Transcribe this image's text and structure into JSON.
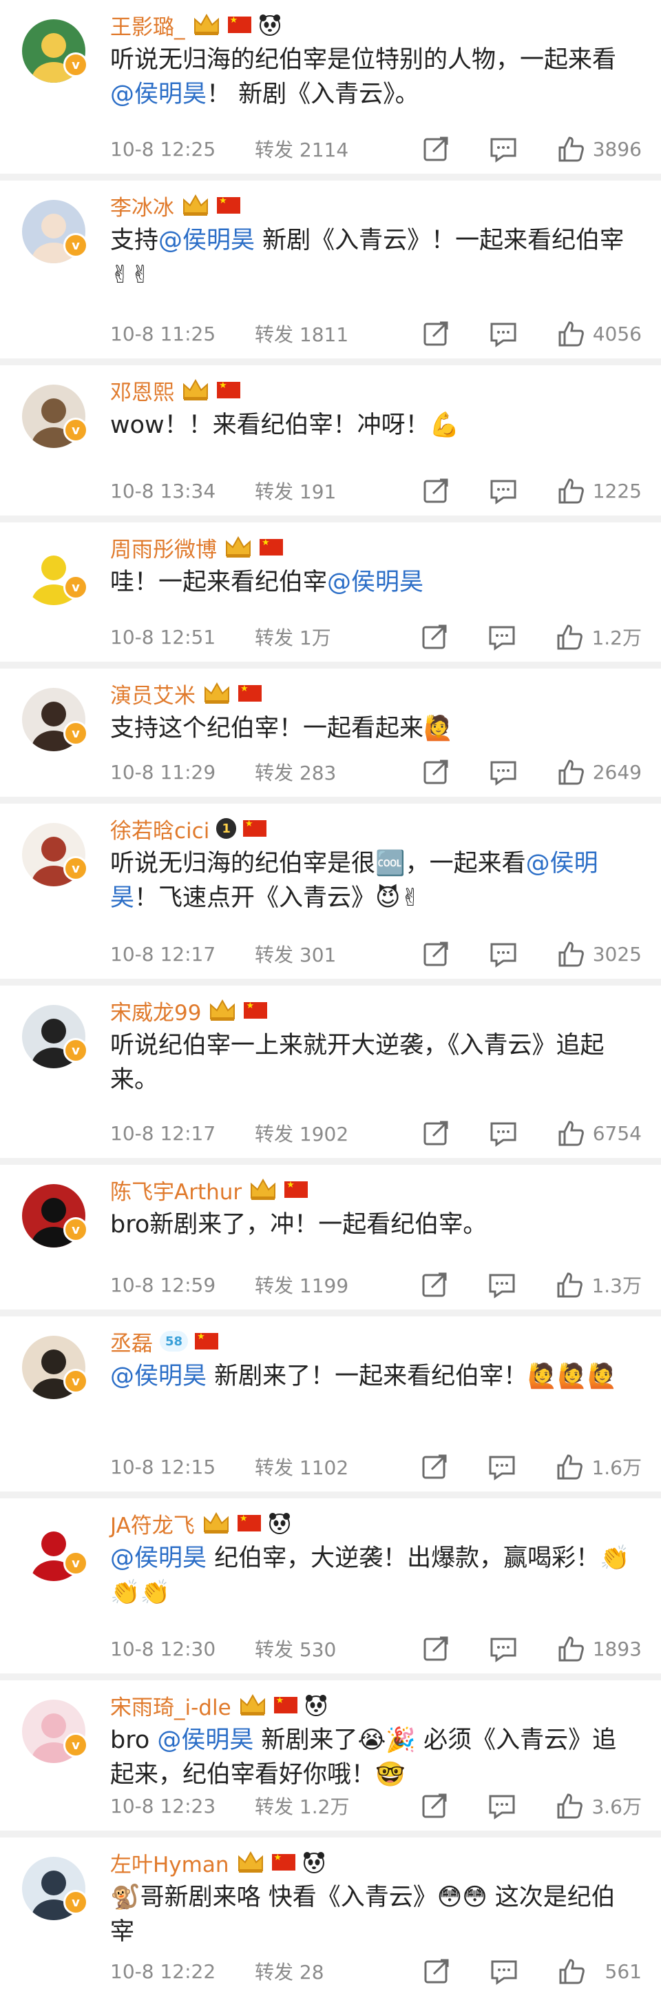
{
  "labels": {
    "share_prefix": "转发"
  },
  "colors": {
    "username": "#e07a2c",
    "mention": "#2b6ec7",
    "meta": "#8a8a8a",
    "verified": "#f5a623"
  },
  "comments": [
    {
      "name": "王影璐_",
      "text": "听说无归海的纪伯宰是位特别的人物，一起来看@侯明昊！ 新剧《入青云》。",
      "date": "10-8 12:25",
      "shares": "2114",
      "likes": "3896",
      "badges": [
        "crown",
        "flag",
        "panda"
      ]
    },
    {
      "name": "李冰冰",
      "text": "支持@侯明昊 新剧《入青云》！一起来看纪伯宰✌✌",
      "date": "10-8 11:25",
      "shares": "1811",
      "likes": "4056",
      "badges": [
        "crown",
        "flag"
      ]
    },
    {
      "name": "邓恩熙",
      "text": "wow！！来看纪伯宰！冲呀！💪",
      "date": "10-8 13:34",
      "shares": "191",
      "likes": "1225",
      "badges": [
        "crown",
        "flag"
      ]
    },
    {
      "name": "周雨彤微博",
      "text": "哇！一起来看纪伯宰@侯明昊",
      "date": "10-8 12:51",
      "shares": "1万",
      "likes": "1.2万",
      "badges": [
        "crown",
        "flag"
      ]
    },
    {
      "name": "演员艾米",
      "text": "支持这个纪伯宰！一起看起来🙋",
      "date": "10-8 11:29",
      "shares": "283",
      "likes": "2649",
      "badges": [
        "crown",
        "flag"
      ]
    },
    {
      "name": "徐若晗cici",
      "text": "听说无归海的纪伯宰是很🆒，一起来看@侯明昊！飞速点开《入青云》😈✌",
      "date": "10-8 12:17",
      "shares": "301",
      "likes": "3025",
      "badges": [
        "lvl-dark",
        "flag"
      ],
      "level": "1"
    },
    {
      "name": "宋威龙99",
      "text": "听说纪伯宰一上来就开大逆袭，《入青云》追起来。",
      "date": "10-8 12:17",
      "shares": "1902",
      "likes": "6754",
      "badges": [
        "crown",
        "flag"
      ]
    },
    {
      "name": "陈飞宇Arthur",
      "text": "bro新剧来了，冲！一起看纪伯宰。",
      "date": "10-8 12:59",
      "shares": "1199",
      "likes": "1.3万",
      "badges": [
        "crown",
        "flag"
      ]
    },
    {
      "name": "丞磊",
      "text": "@侯明昊 新剧来了！一起来看纪伯宰！🙋🙋🙋",
      "date": "10-8 12:15",
      "shares": "1102",
      "likes": "1.6万",
      "badges": [
        "lvl",
        "flag"
      ],
      "level": "58"
    },
    {
      "name": "JA符龙飞",
      "text": "@侯明昊 纪伯宰，大逆袭！出爆款，赢喝彩！👏👏👏",
      "date": "10-8 12:30",
      "shares": "530",
      "likes": "1893",
      "badges": [
        "crown",
        "flag",
        "panda"
      ]
    },
    {
      "name": "宋雨琦_i-dle",
      "text": "bro @侯明昊 新剧来了😭🎉 必须《入青云》追起来，纪伯宰看好你哦！🤓",
      "date": "10-8 12:23",
      "shares": "1.2万",
      "likes": "3.6万",
      "badges": [
        "crown",
        "flag",
        "panda"
      ]
    },
    {
      "name": "左叶Hyman",
      "text": "🐒哥新剧来咯 快看《入青云》😳😳 这次是纪伯宰",
      "date": "10-8 12:22",
      "shares": "28",
      "likes": "561",
      "badges": [
        "crown",
        "flag",
        "panda"
      ]
    }
  ]
}
